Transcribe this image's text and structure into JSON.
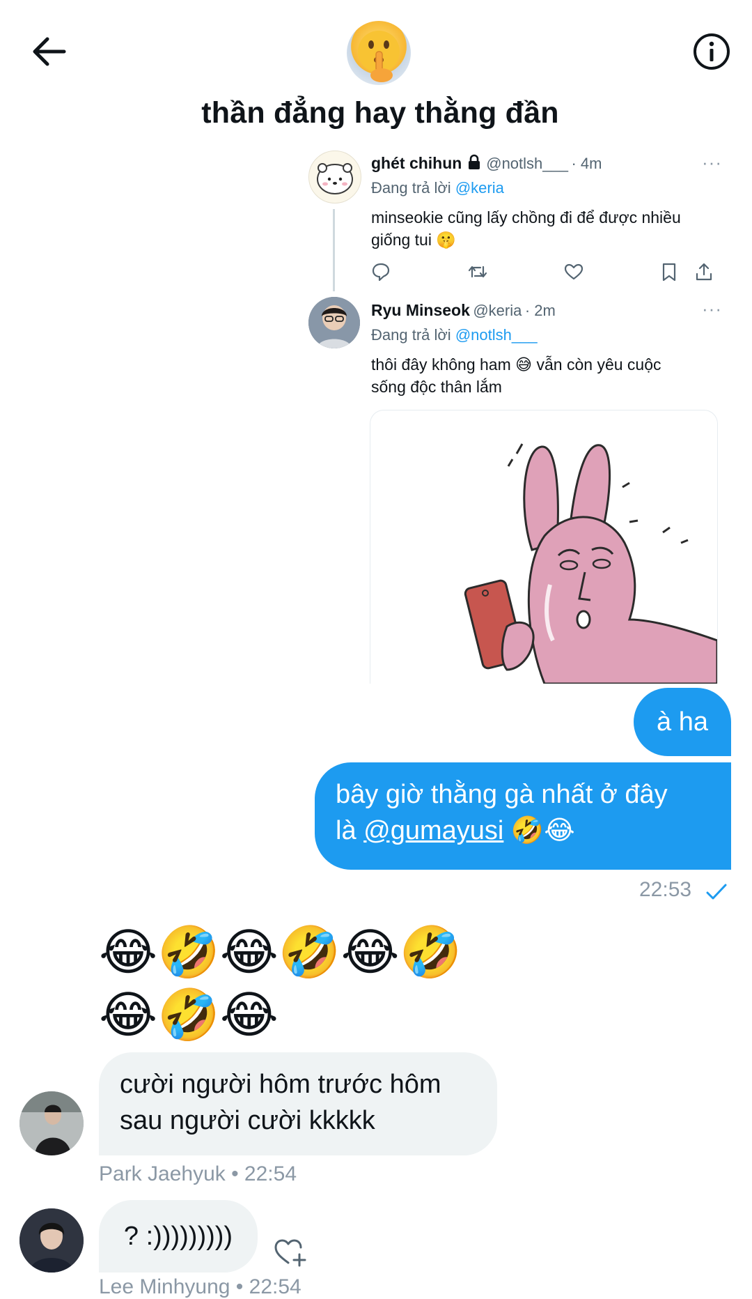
{
  "header": {
    "title": "thần đẳng hay thằng đần"
  },
  "tweets": [
    {
      "name": "ghét chihun",
      "handle": "@notlsh___",
      "time": "· 4m",
      "reply_prefix": "Đang trả lời",
      "reply_to": "@keria",
      "body_line1": "minseokie cũng lấy chồng đi để được nhiều",
      "body_line2": "giống tui 🤫",
      "more": "···"
    },
    {
      "name": "Ryu Minseok",
      "handle": "@keria",
      "time": "· 2m",
      "reply_prefix": "Đang trả lời",
      "reply_to": "@notlsh___",
      "body_line1": "thôi đây không ham 😅 vẫn còn yêu cuộc",
      "body_line2": "sống độc thân lắm",
      "more": "···"
    }
  ],
  "messages": {
    "out1": "à ha",
    "out2_line1": "bây giờ thằng gà nhất ở đây",
    "out2_prefix": "là ",
    "out2_mention": "@gumayusi",
    "out2_emoji": " 🤣😂",
    "out_time": "22:53",
    "emoji_row1": "😂🤣😂🤣😂🤣",
    "emoji_row2": "😂🤣😂",
    "in1_line1": "cười người hôm trước hôm",
    "in1_line2": "sau người cười kkkkk",
    "in1_meta": "Park Jaehyuk • 22:54",
    "in2": "? :)))))))))",
    "in2_meta": "Lee Minhyung • 22:54"
  },
  "colors": {
    "accent": "#1d9bf0",
    "incoming_bubble": "#eff3f4",
    "meta_gray": "#8b98a5"
  },
  "icons": {
    "back": "arrow-left-icon",
    "info": "info-icon",
    "reply": "reply-icon",
    "retweet": "retweet-icon",
    "like": "heart-icon",
    "bookmark": "bookmark-icon",
    "share": "share-icon",
    "react": "add-reaction-icon",
    "read": "check-icon"
  }
}
